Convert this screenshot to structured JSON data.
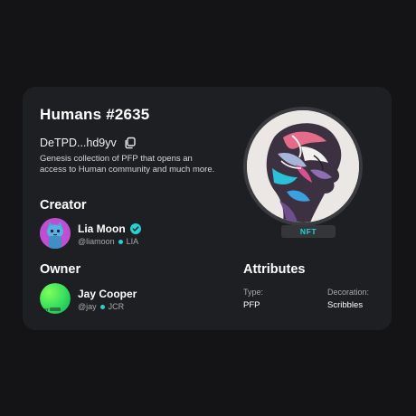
{
  "card": {
    "title": "Humans #2635",
    "address": "DeTPD...hd9yv",
    "description": "Genesis collection of PFP that opens an access to Human community and much more."
  },
  "creator": {
    "section_label": "Creator",
    "name": "Lia Moon",
    "handle": "@liamoon",
    "tag": "LIA",
    "verified": true
  },
  "owner": {
    "section_label": "Owner",
    "name": "Jay Cooper",
    "handle": "@jay",
    "tag": "JCR",
    "avatar_badge": "NFT"
  },
  "artwork": {
    "badge": "NFT"
  },
  "attributes": {
    "section_label": "Attributes",
    "items": [
      {
        "label": "Type:",
        "value": "PFP"
      },
      {
        "label": "Decoration:",
        "value": "Scribbles"
      }
    ]
  },
  "colors": {
    "accent": "#24d2d6",
    "card_bg": "#1e1f22",
    "page_bg": "#141416"
  }
}
